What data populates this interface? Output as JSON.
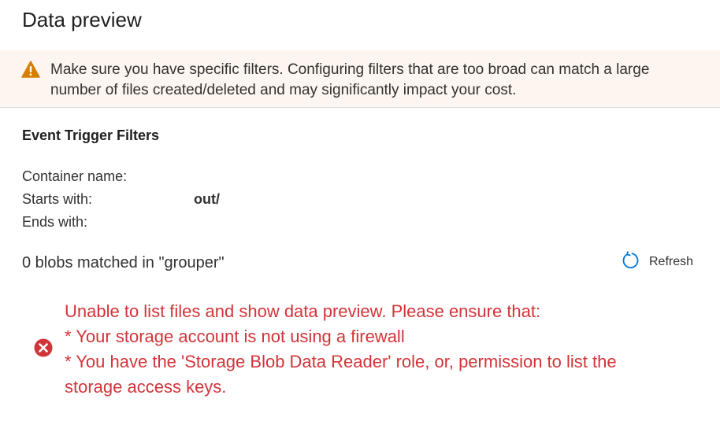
{
  "panel": {
    "title": "Data preview"
  },
  "warning": {
    "icon": "warning-icon",
    "icon_color": "#d67f00",
    "background": "#fdf6f0",
    "message": "Make sure you have specific filters. Configuring filters that are too broad can match a large number of files created/deleted and may significantly impact your cost."
  },
  "filters": {
    "heading": "Event Trigger Filters",
    "container_label": "Container name:",
    "container_value": "",
    "starts_label": "Starts with:",
    "starts_value": "out/",
    "ends_label": "Ends with:",
    "ends_value": ""
  },
  "results": {
    "matched_text": "0 blobs matched in \"grouper\"",
    "refresh_label": "Refresh",
    "refresh_icon": "refresh-icon",
    "accent_color": "#0078d4"
  },
  "error": {
    "icon": "error-circle-icon",
    "color": "#d13438",
    "lines": [
      "Unable to list files and show data preview. Please ensure that:",
      "* Your storage account is not using a firewall",
      "* You have the 'Storage Blob Data Reader' role, or, permission to list the",
      "storage access keys."
    ]
  }
}
